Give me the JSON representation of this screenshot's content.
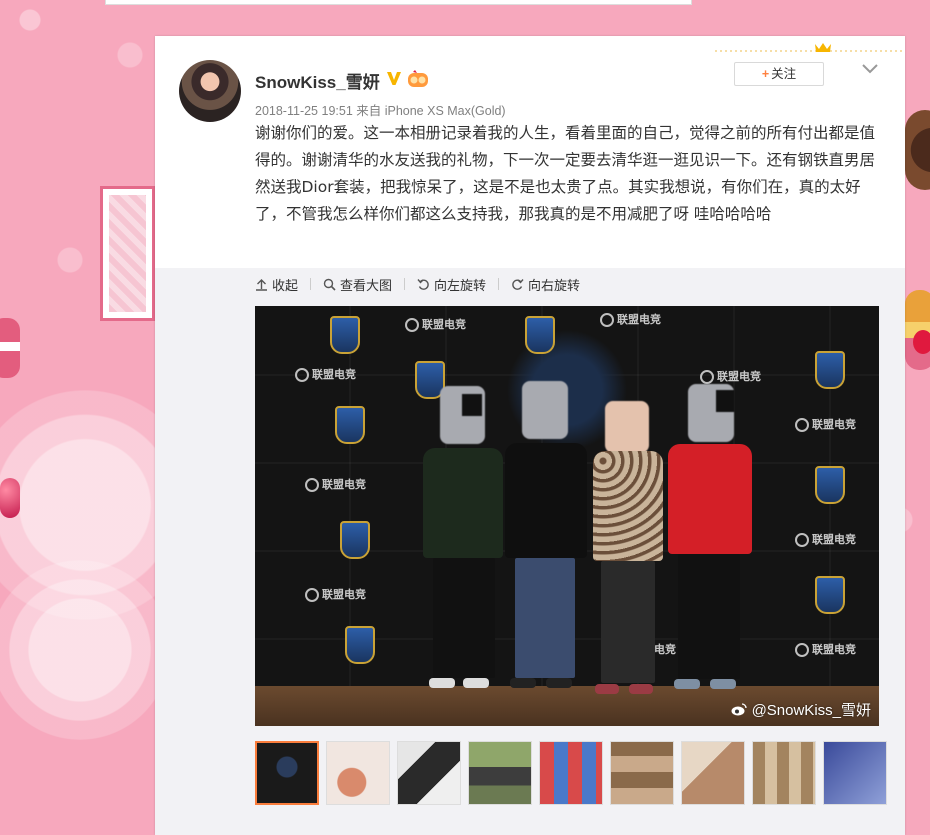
{
  "colors": {
    "page_bg": "#f7a8bd",
    "follow_plus": "#ff8140",
    "active_thumb_border": "#fa7d3c",
    "verified_gold": "#f7b500"
  },
  "post": {
    "author": "SnowKiss_雪妍",
    "meta": "2018-11-25 19:51 来自 iPhone XS Max(Gold)",
    "follow_label": "关注",
    "text": "谢谢你们的爱。这一本相册记录着我的人生，看着里面的自己，觉得之前的所有付出都是值得的。谢谢清华的水友送我的礼物，下一次一定要去清华逛一逛见识一下。还有钢铁直男居然送我Dior套装，把我惊呆了，这是不是也太贵了点。其实我想说，有你们在，真的太好了，不管我怎么样你们都这么支持我，那我真的是不用减肥了呀 哇哈哈哈哈"
  },
  "toolbar": {
    "collapse": "收起",
    "view_large": "查看大图",
    "rotate_left": "向左旋转",
    "rotate_right": "向右旋转"
  },
  "photo": {
    "watermark": "@SnowKiss_雪妍",
    "backdrop_logo_text": "联盟电竞"
  },
  "thumbnails": {
    "count": 9,
    "active_index": 0
  },
  "icons": [
    "verified-v-icon",
    "vip-badge-icon",
    "chevron-down-icon",
    "collapse-arrow-icon",
    "search-icon",
    "rotate-left-icon",
    "rotate-right-icon",
    "weibo-logo-icon"
  ]
}
